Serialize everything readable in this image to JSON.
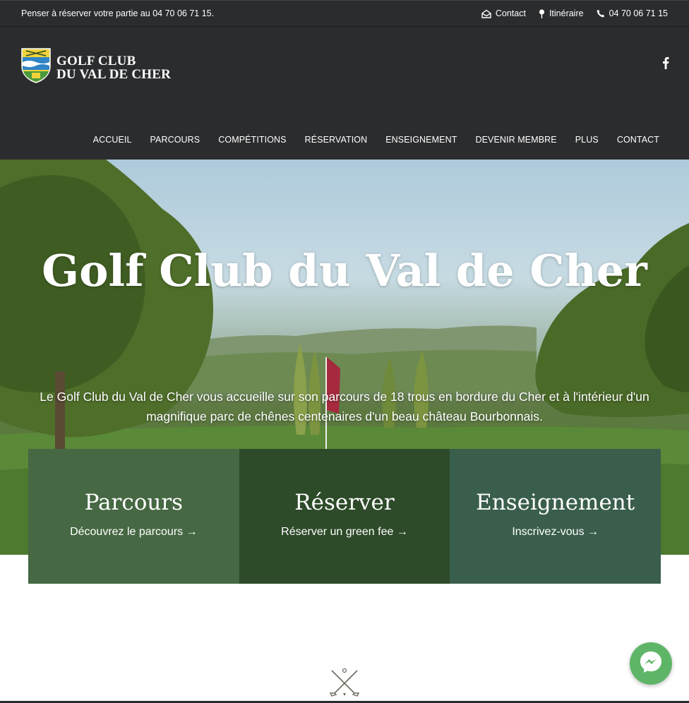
{
  "topbar": {
    "notice": "Penser à réserver votre partie au 04 70 06 71 15.",
    "links": [
      {
        "label": "Contact",
        "icon": "envelope-icon"
      },
      {
        "label": "Itinéraire",
        "icon": "map-pin-icon"
      },
      {
        "label": "04 70 06 71 15",
        "icon": "phone-icon"
      }
    ]
  },
  "logo": {
    "line1": "GOLF CLUB",
    "line2": "DU VAL DE CHER"
  },
  "social": {
    "icon": "facebook-icon"
  },
  "nav": [
    "ACCUEIL",
    "PARCOURS",
    "COMPÉTITIONS",
    "RÉSERVATION",
    "ENSEIGNEMENT",
    "DEVENIR MEMBRE",
    "PLUS",
    "CONTACT"
  ],
  "hero": {
    "title": "Golf Club du Val de Cher",
    "subtitle": "Le Golf Club du Val de Cher vous accueille sur son parcours de 18 trous en bordure du Cher et à l'intérieur d'un magnifique parc de chênes centenaires d'un beau château Bourbonnais."
  },
  "cards": [
    {
      "title": "Parcours",
      "link": "Découvrez le parcours →",
      "color": "#466843"
    },
    {
      "title": "Réserver",
      "link": "Réserver un green fee →",
      "color": "#2d4a29"
    },
    {
      "title": "Enseignement",
      "link": "Inscrivez-vous →",
      "color": "#3a5e4c"
    }
  ],
  "icons": {
    "emblem": "crossed-golf-clubs-icon",
    "chat": "messenger-icon"
  },
  "colors": {
    "header": "#2b2c2e",
    "chat": "#5fb567"
  }
}
